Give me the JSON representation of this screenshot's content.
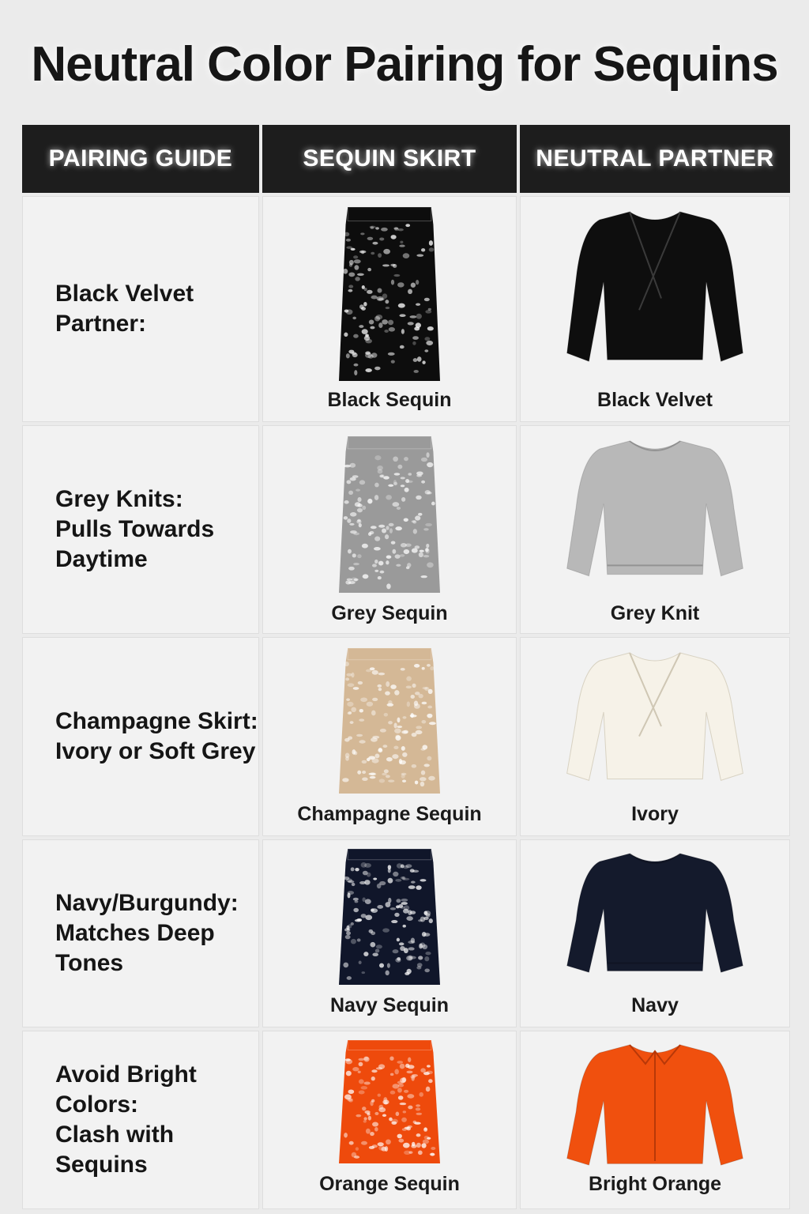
{
  "title": "Neutral Color Pairing for Sequins",
  "headers": [
    "PAIRING GUIDE",
    "SEQUIN SKIRT",
    "NEUTRAL PARTNER"
  ],
  "rows": [
    {
      "guide": "Black Velvet\nPartner:",
      "skirt_label": "Black Sequin",
      "partner_label": "Black Velvet",
      "skirt_color": "#0d0d0d",
      "partner_color": "#0e0e0e",
      "partner_icon": "velvet-wrap-top-icon"
    },
    {
      "guide": "Grey Knits:\nPulls Towards\nDaytime",
      "skirt_label": "Grey Sequin",
      "partner_label": "Grey Knit",
      "skirt_color": "#9a9a9a",
      "partner_color": "#b8b8b8",
      "partner_icon": "grey-knit-sweater-icon"
    },
    {
      "guide": "Champagne Skirt:\nIvory or Soft Grey",
      "skirt_label": "Champagne Sequin",
      "partner_label": "Ivory",
      "skirt_color": "#d4b896",
      "partner_color": "#f6f2e8",
      "partner_icon": "ivory-wrap-blouse-icon"
    },
    {
      "guide": "Navy/Burgundy:\nMatches Deep\nTones",
      "skirt_label": "Navy Sequin",
      "partner_label": "Navy",
      "skirt_color": "#10162a",
      "partner_color": "#141a2c",
      "partner_icon": "navy-sweater-icon"
    },
    {
      "guide": "Avoid Bright\nColors:\nClash with Sequins",
      "skirt_label": "Orange Sequin",
      "partner_label": "Bright Orange",
      "skirt_color": "#ee4a0c",
      "partner_color": "#f0500e",
      "partner_icon": "orange-shirt-icon"
    }
  ]
}
